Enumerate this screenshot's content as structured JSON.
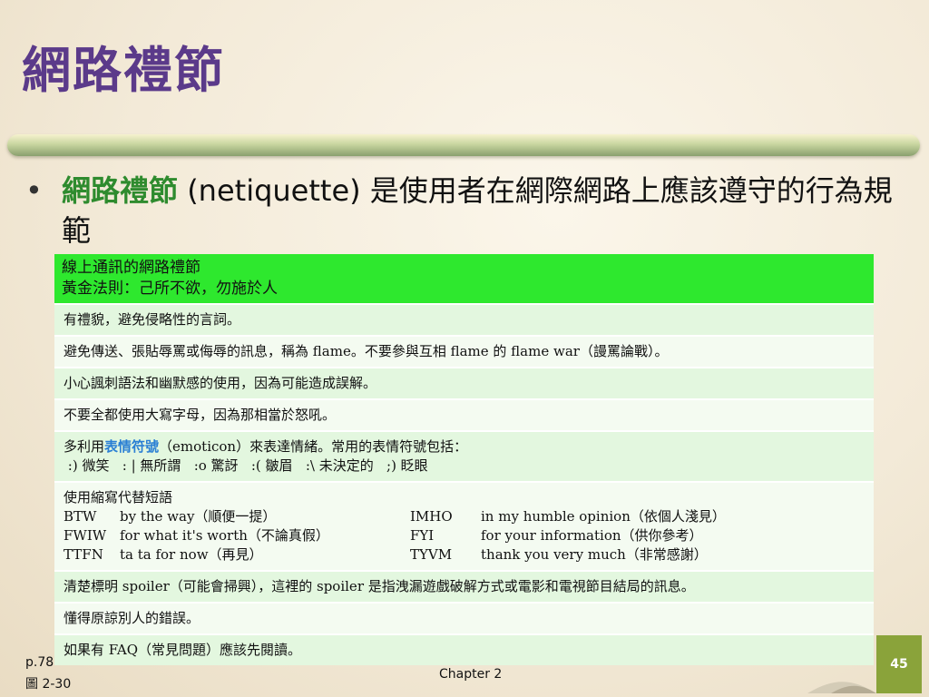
{
  "slide": {
    "title": "網路禮節",
    "bullet_symbol": "•",
    "bullet_highlight": "網路禮節",
    "bullet_rest": " (netiquette) 是使用者在網際網路上應該遵守的行為規範"
  },
  "table": {
    "header_line1": "線上通訊的網路禮節",
    "header_line2": "黃金法則：己所不欲，勿施於人",
    "rows": [
      "有禮貌，避免侵略性的言詞。",
      "避免傳送、張貼辱罵或侮辱的訊息，稱為 flame。不要參與互相 flame 的 flame war（謾罵論戰）。",
      "小心諷刺語法和幽默感的使用，因為可能造成誤解。",
      "不要全都使用大寫字母，因為那相當於怒吼。"
    ],
    "emoticon_row": {
      "prefix": "多利用",
      "highlight": "表情符號",
      "suffix": "（emoticon）來表達情緒。常用的表情符號包括：",
      "examples": " :) 微笑   : | 無所謂   :o 驚訝   :( 皺眉   :\\ 未決定的   ;) 眨眼"
    },
    "abbr_row": {
      "heading": "使用縮寫代替短語",
      "items": [
        {
          "a1": "BTW",
          "d1": "by the way（順便一提）",
          "a2": "IMHO",
          "d2": "in my humble opinion（依個人淺見）"
        },
        {
          "a1": "FWIW",
          "d1": "for what it's worth（不論真假）",
          "a2": "FYI",
          "d2": "for your information（供你參考）"
        },
        {
          "a1": "TTFN",
          "d1": "ta ta for now（再見）",
          "a2": "TYVM",
          "d2": "thank you very much（非常感謝）"
        }
      ]
    },
    "rows_after": [
      "清楚標明 spoiler（可能會掃興），這裡的 spoiler 是指洩漏遊戲破解方式或電影和電視節目結局的訊息。",
      "懂得原諒別人的錯誤。",
      "如果有 FAQ（常見問題）應該先閱讀。"
    ]
  },
  "footer": {
    "ref_page": "p.78",
    "ref_fig": "圖 2-30",
    "chapter": "Chapter 2",
    "page_number": "45"
  },
  "colors": {
    "title": "#5b3a8a",
    "header_green": "#2ee82e",
    "highlight_green": "#2e8b2e",
    "page_badge": "#8aa33a"
  }
}
